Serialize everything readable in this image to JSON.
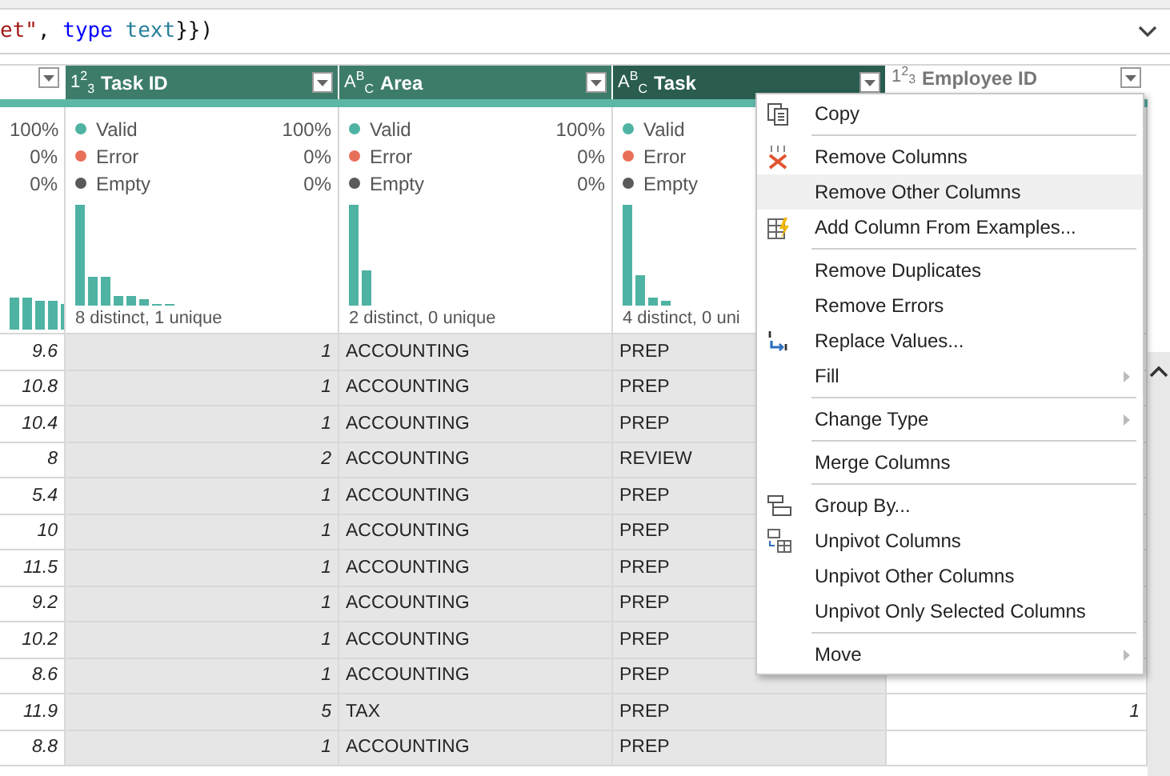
{
  "formula_bar": {
    "tokens": [
      {
        "text": "et\"",
        "kind": "string"
      },
      {
        "text": ", ",
        "kind": "punct"
      },
      {
        "text": "type ",
        "kind": "keyword"
      },
      {
        "text": "text",
        "kind": "type"
      },
      {
        "text": "}})",
        "kind": "punct"
      }
    ]
  },
  "table": {
    "columns": [
      {
        "kind": "number",
        "selected": false,
        "active": false,
        "stats": [
          {
            "pct": "100%"
          },
          {
            "pct": "0%"
          },
          {
            "pct": "0%"
          }
        ]
      },
      {
        "title": "Task ID",
        "type_icon": "1$^{2}$$_{3}$",
        "kind": "number",
        "selected": true,
        "active": false,
        "stats": [
          {
            "label": "Valid",
            "pct": "100%",
            "color": "#4fb3a3"
          },
          {
            "label": "Error",
            "pct": "0%",
            "color": "#e8705a"
          },
          {
            "label": "Empty",
            "pct": "0%",
            "color": "#5a5a5a"
          }
        ],
        "summary": "8 distinct, 1 unique"
      },
      {
        "title": "Area",
        "type_icon": "A$^{B}$$_{C}$",
        "kind": "text",
        "selected": true,
        "active": false,
        "stats": [
          {
            "label": "Valid",
            "pct": "100%",
            "color": "#4fb3a3"
          },
          {
            "label": "Error",
            "pct": "0%",
            "color": "#e8705a"
          },
          {
            "label": "Empty",
            "pct": "0%",
            "color": "#5a5a5a"
          }
        ],
        "summary": "2 distinct, 0 unique"
      },
      {
        "title": "Task",
        "type_icon": "A$^{B}$$_{C}$",
        "kind": "text",
        "selected": true,
        "active": true,
        "stats": [
          {
            "label": "Valid",
            "color": "#4fb3a3"
          },
          {
            "label": "Error",
            "color": "#e8705a"
          },
          {
            "label": "Empty",
            "color": "#5a5a5a"
          }
        ],
        "summary": "4 distinct, 0 uni"
      },
      {
        "title": "Employee ID",
        "type_icon": "1$^{2}$$_{3}$",
        "kind": "number",
        "selected": false,
        "active": false
      }
    ],
    "rows": [
      {
        "cells": [
          "9.6",
          "1",
          "ACCOUNTING",
          "PREP"
        ]
      },
      {
        "cells": [
          "10.8",
          "1",
          "ACCOUNTING",
          "PREP"
        ]
      },
      {
        "cells": [
          "10.4",
          "1",
          "ACCOUNTING",
          "PREP"
        ]
      },
      {
        "cells": [
          "8",
          "2",
          "ACCOUNTING",
          "REVIEW"
        ]
      },
      {
        "cells": [
          "5.4",
          "1",
          "ACCOUNTING",
          "PREP"
        ]
      },
      {
        "cells": [
          "10",
          "1",
          "ACCOUNTING",
          "PREP"
        ]
      },
      {
        "cells": [
          "11.5",
          "1",
          "ACCOUNTING",
          "PREP"
        ]
      },
      {
        "cells": [
          "9.2",
          "1",
          "ACCOUNTING",
          "PREP"
        ]
      },
      {
        "cells": [
          "10.2",
          "1",
          "ACCOUNTING",
          "PREP"
        ]
      },
      {
        "cells": [
          "8.6",
          "1",
          "ACCOUNTING",
          "PREP"
        ]
      },
      {
        "cells": [
          "11.9",
          "5",
          "TAX",
          "PREP",
          "1"
        ]
      },
      {
        "cells": [
          "8.8",
          "1",
          "ACCOUNTING",
          "PREP"
        ]
      }
    ]
  },
  "context_menu": {
    "groups": [
      [
        {
          "label": "Copy",
          "selected": false,
          "submenu": false
        }
      ],
      [
        {
          "label": "Remove Columns",
          "selected": false,
          "submenu": false
        },
        {
          "label": "Remove Other Columns",
          "selected": true,
          "submenu": false
        },
        {
          "label": "Add Column From Examples...",
          "selected": false,
          "submenu": false
        }
      ],
      [
        {
          "label": "Remove Duplicates",
          "selected": false,
          "submenu": false
        },
        {
          "label": "Remove Errors",
          "selected": false,
          "submenu": false
        },
        {
          "label": "Replace Values...",
          "selected": false,
          "submenu": false
        },
        {
          "label": "Fill",
          "selected": false,
          "submenu": true
        }
      ],
      [
        {
          "label": "Change Type",
          "selected": false,
          "submenu": true
        }
      ],
      [
        {
          "label": "Merge Columns",
          "selected": false,
          "submenu": false
        }
      ],
      [
        {
          "label": "Group By...",
          "selected": false,
          "submenu": false
        },
        {
          "label": "Unpivot Columns",
          "selected": false,
          "submenu": false
        },
        {
          "label": "Unpivot Other Columns",
          "selected": false,
          "submenu": false
        },
        {
          "label": "Unpivot Only Selected Columns",
          "selected": false,
          "submenu": false
        }
      ],
      [
        {
          "label": "Move",
          "selected": false,
          "submenu": true
        }
      ]
    ]
  }
}
